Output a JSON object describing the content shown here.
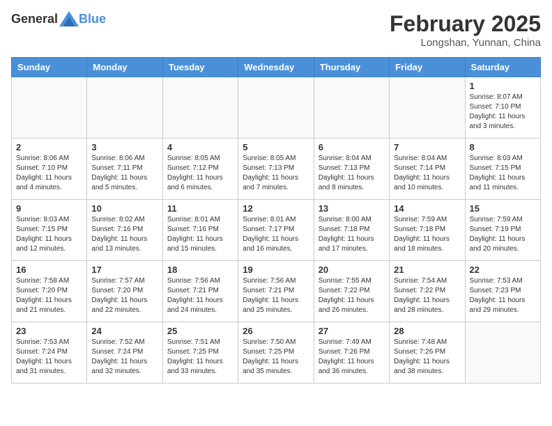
{
  "header": {
    "logo_general": "General",
    "logo_blue": "Blue",
    "month_title": "February 2025",
    "location": "Longshan, Yunnan, China"
  },
  "days_of_week": [
    "Sunday",
    "Monday",
    "Tuesday",
    "Wednesday",
    "Thursday",
    "Friday",
    "Saturday"
  ],
  "weeks": [
    [
      {
        "day": "",
        "info": ""
      },
      {
        "day": "",
        "info": ""
      },
      {
        "day": "",
        "info": ""
      },
      {
        "day": "",
        "info": ""
      },
      {
        "day": "",
        "info": ""
      },
      {
        "day": "",
        "info": ""
      },
      {
        "day": "1",
        "info": "Sunrise: 8:07 AM\nSunset: 7:10 PM\nDaylight: 11 hours\nand 3 minutes."
      }
    ],
    [
      {
        "day": "2",
        "info": "Sunrise: 8:06 AM\nSunset: 7:10 PM\nDaylight: 11 hours\nand 4 minutes."
      },
      {
        "day": "3",
        "info": "Sunrise: 8:06 AM\nSunset: 7:11 PM\nDaylight: 11 hours\nand 5 minutes."
      },
      {
        "day": "4",
        "info": "Sunrise: 8:05 AM\nSunset: 7:12 PM\nDaylight: 11 hours\nand 6 minutes."
      },
      {
        "day": "5",
        "info": "Sunrise: 8:05 AM\nSunset: 7:13 PM\nDaylight: 11 hours\nand 7 minutes."
      },
      {
        "day": "6",
        "info": "Sunrise: 8:04 AM\nSunset: 7:13 PM\nDaylight: 11 hours\nand 8 minutes."
      },
      {
        "day": "7",
        "info": "Sunrise: 8:04 AM\nSunset: 7:14 PM\nDaylight: 11 hours\nand 10 minutes."
      },
      {
        "day": "8",
        "info": "Sunrise: 8:03 AM\nSunset: 7:15 PM\nDaylight: 11 hours\nand 11 minutes."
      }
    ],
    [
      {
        "day": "9",
        "info": "Sunrise: 8:03 AM\nSunset: 7:15 PM\nDaylight: 11 hours\nand 12 minutes."
      },
      {
        "day": "10",
        "info": "Sunrise: 8:02 AM\nSunset: 7:16 PM\nDaylight: 11 hours\nand 13 minutes."
      },
      {
        "day": "11",
        "info": "Sunrise: 8:01 AM\nSunset: 7:16 PM\nDaylight: 11 hours\nand 15 minutes."
      },
      {
        "day": "12",
        "info": "Sunrise: 8:01 AM\nSunset: 7:17 PM\nDaylight: 11 hours\nand 16 minutes."
      },
      {
        "day": "13",
        "info": "Sunrise: 8:00 AM\nSunset: 7:18 PM\nDaylight: 11 hours\nand 17 minutes."
      },
      {
        "day": "14",
        "info": "Sunrise: 7:59 AM\nSunset: 7:18 PM\nDaylight: 11 hours\nand 18 minutes."
      },
      {
        "day": "15",
        "info": "Sunrise: 7:59 AM\nSunset: 7:19 PM\nDaylight: 11 hours\nand 20 minutes."
      }
    ],
    [
      {
        "day": "16",
        "info": "Sunrise: 7:58 AM\nSunset: 7:20 PM\nDaylight: 11 hours\nand 21 minutes."
      },
      {
        "day": "17",
        "info": "Sunrise: 7:57 AM\nSunset: 7:20 PM\nDaylight: 11 hours\nand 22 minutes."
      },
      {
        "day": "18",
        "info": "Sunrise: 7:56 AM\nSunset: 7:21 PM\nDaylight: 11 hours\nand 24 minutes."
      },
      {
        "day": "19",
        "info": "Sunrise: 7:56 AM\nSunset: 7:21 PM\nDaylight: 11 hours\nand 25 minutes."
      },
      {
        "day": "20",
        "info": "Sunrise: 7:55 AM\nSunset: 7:22 PM\nDaylight: 11 hours\nand 26 minutes."
      },
      {
        "day": "21",
        "info": "Sunrise: 7:54 AM\nSunset: 7:22 PM\nDaylight: 11 hours\nand 28 minutes."
      },
      {
        "day": "22",
        "info": "Sunrise: 7:53 AM\nSunset: 7:23 PM\nDaylight: 11 hours\nand 29 minutes."
      }
    ],
    [
      {
        "day": "23",
        "info": "Sunrise: 7:53 AM\nSunset: 7:24 PM\nDaylight: 11 hours\nand 31 minutes."
      },
      {
        "day": "24",
        "info": "Sunrise: 7:52 AM\nSunset: 7:24 PM\nDaylight: 11 hours\nand 32 minutes."
      },
      {
        "day": "25",
        "info": "Sunrise: 7:51 AM\nSunset: 7:25 PM\nDaylight: 11 hours\nand 33 minutes."
      },
      {
        "day": "26",
        "info": "Sunrise: 7:50 AM\nSunset: 7:25 PM\nDaylight: 11 hours\nand 35 minutes."
      },
      {
        "day": "27",
        "info": "Sunrise: 7:49 AM\nSunset: 7:26 PM\nDaylight: 11 hours\nand 36 minutes."
      },
      {
        "day": "28",
        "info": "Sunrise: 7:48 AM\nSunset: 7:26 PM\nDaylight: 11 hours\nand 38 minutes."
      },
      {
        "day": "",
        "info": ""
      }
    ]
  ]
}
